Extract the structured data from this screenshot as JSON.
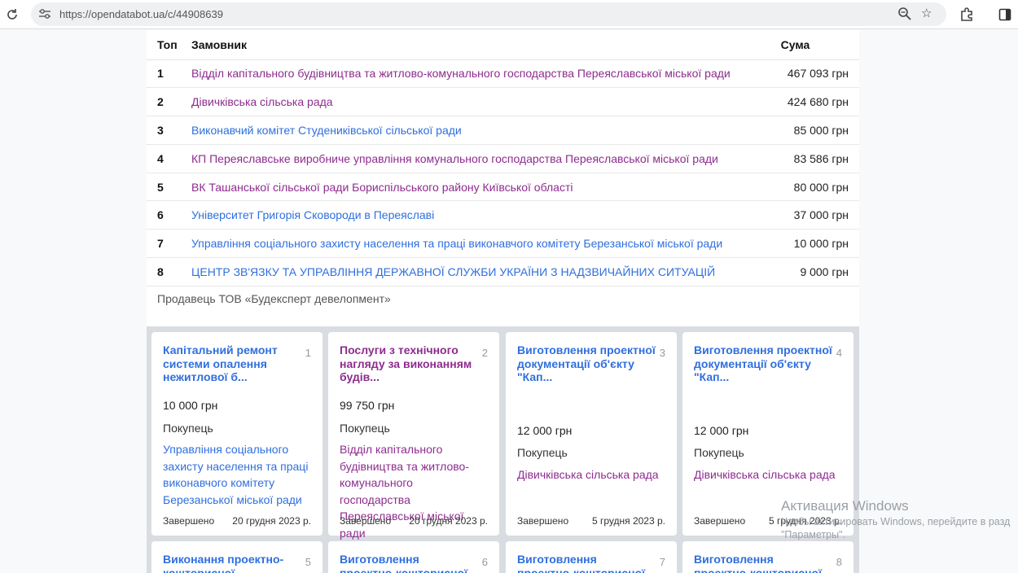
{
  "browser": {
    "url": "https://opendatabot.ua/c/44908639"
  },
  "table": {
    "headers": {
      "rank": "Топ",
      "customer": "Замовник",
      "sum": "Сума"
    },
    "rows": [
      {
        "rank": "1",
        "name": "Відділ капітального будівництва та житлово-комунального господарства Переяславської міської ради",
        "sum": "467 093 грн",
        "visited": true
      },
      {
        "rank": "2",
        "name": "Дівичківська сільська рада",
        "sum": "424 680 грн",
        "visited": true
      },
      {
        "rank": "3",
        "name": "Виконавчий комітет Студениківської сільської ради",
        "sum": "85 000 грн",
        "visited": false
      },
      {
        "rank": "4",
        "name": "КП Переяславське виробниче управління комунального господарства Переяславської міської ради",
        "sum": "83 586 грн",
        "visited": true
      },
      {
        "rank": "5",
        "name": "ВК Ташанської сільської ради Бориспільського району Київської області",
        "sum": "80 000 грн",
        "visited": true
      },
      {
        "rank": "6",
        "name": "Університет Григорія Сковороди в Переяславі",
        "sum": "37 000 грн",
        "visited": false
      },
      {
        "rank": "7",
        "name": "Управління соціального захисту населення та праці виконавчого комітету Березанської міської ради",
        "sum": "10 000 грн",
        "visited": false
      },
      {
        "rank": "8",
        "name": "ЦЕНТР ЗВ'ЯЗКУ ТА УПРАВЛІННЯ ДЕРЖАВНОЇ СЛУЖБИ УКРАЇНИ З НАДЗВИЧАЙНИХ СИТУАЦІЙ",
        "sum": "9 000 грн",
        "visited": false
      }
    ]
  },
  "seller": "Продавець ТОВ «Будексперт девелопмент»",
  "cards": [
    {
      "idx": "1",
      "title": "Капітальний ремонт системи опалення нежитлової б...",
      "title_visited": false,
      "amount": "10 000 грн",
      "buyer_label": "Покупець",
      "buyer": "Управління соціального захисту населення та праці виконавчого комітету Березанської міської ради",
      "buyer_visited": false,
      "status": "Завершено",
      "date": "20 грудня 2023 р."
    },
    {
      "idx": "2",
      "title": "Послуги з технічного нагляду за виконанням будів...",
      "title_visited": true,
      "amount": "99 750 грн",
      "buyer_label": "Покупець",
      "buyer": "Відділ капітального будівництва та житлово-комунального господарства Переяславської міської ради",
      "buyer_visited": true,
      "status": "Завершено",
      "date": "20 грудня 2023 р."
    },
    {
      "idx": "3",
      "title": "Виготовлення проектної документації об'єкту \"Кап...",
      "title_visited": false,
      "amount": "12 000 грн",
      "buyer_label": "Покупець",
      "buyer": "Дівичківська сільська рада",
      "buyer_visited": true,
      "status": "Завершено",
      "date": "5 грудня 2023 р."
    },
    {
      "idx": "4",
      "title": "Виготовлення проектної документації об'єкту \"Кап...",
      "title_visited": false,
      "amount": "12 000 грн",
      "buyer_label": "Покупець",
      "buyer": "Дівичківська сільська рада",
      "buyer_visited": true,
      "status": "Завершено",
      "date": "5 грудня 2023 р."
    },
    {
      "idx": "5",
      "title": "Виконання проектно-кошторисної",
      "title_visited": false
    },
    {
      "idx": "6",
      "title": "Виготовлення проектно-кошторисної",
      "title_visited": false
    },
    {
      "idx": "7",
      "title": "Виготовлення проектно-кошторисної",
      "title_visited": false
    },
    {
      "idx": "8",
      "title": "Виготовлення проектно-кошторисної",
      "title_visited": false
    }
  ],
  "watermark": {
    "line1": "Активация Windows",
    "line2": "Чтобы активировать Windows, перейдите в разд",
    "line3": "\"Параметры\"."
  },
  "colors": {
    "link": "#2f6fde",
    "visited": "#8e2c8e"
  }
}
